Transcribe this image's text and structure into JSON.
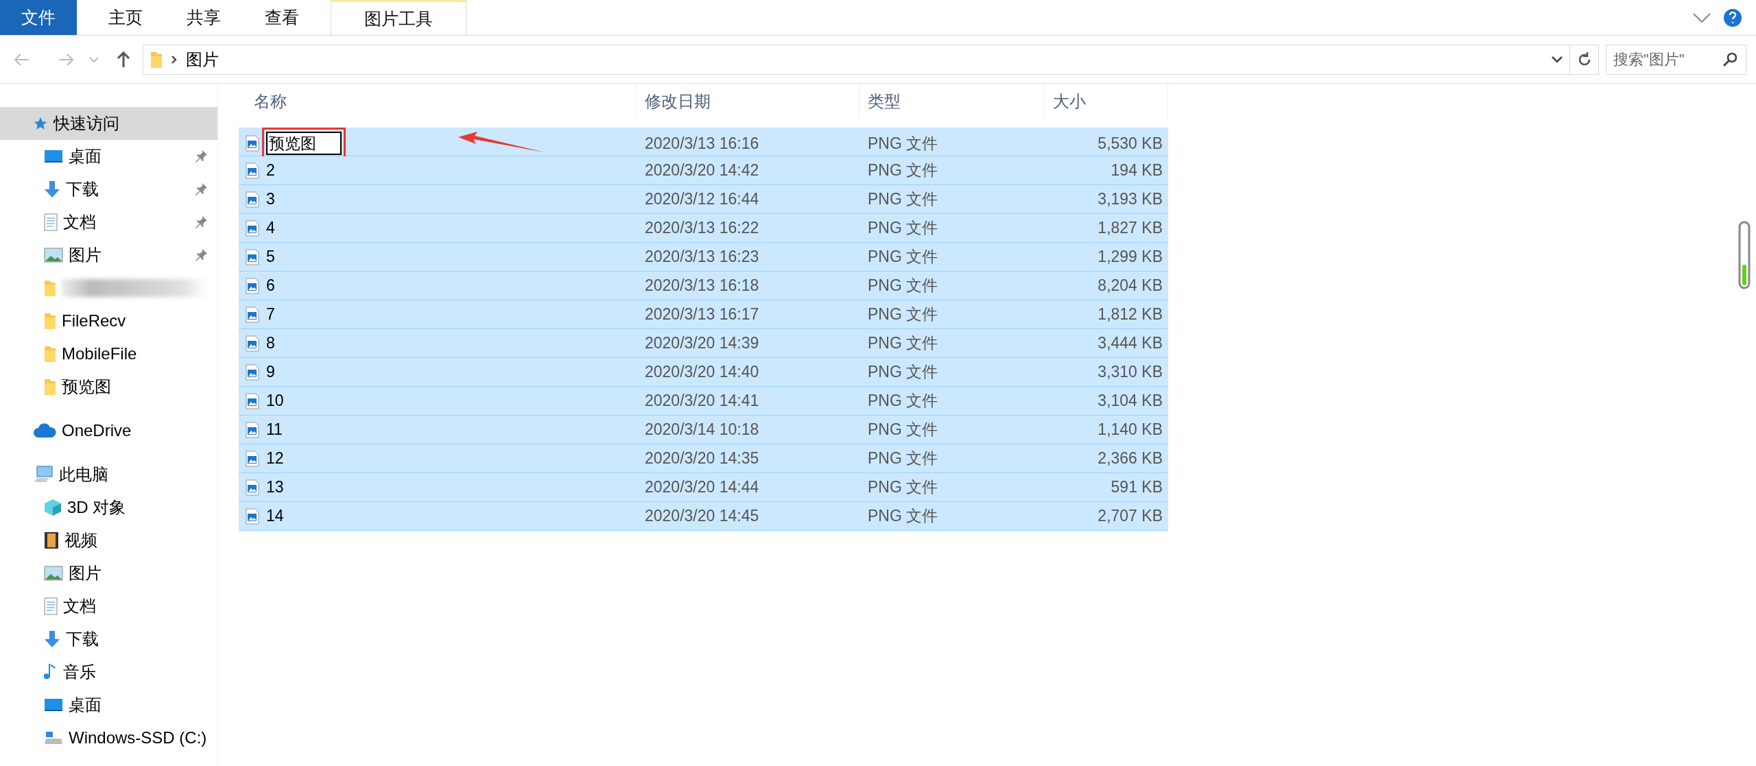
{
  "ribbon": {
    "tabs": [
      {
        "label": "文件",
        "kind": "file"
      },
      {
        "label": "主页",
        "kind": "tab"
      },
      {
        "label": "共享",
        "kind": "tab"
      },
      {
        "label": "查看",
        "kind": "tab"
      },
      {
        "label": "图片工具",
        "kind": "context"
      }
    ]
  },
  "address_bar": {
    "crumbs": [
      "图片"
    ],
    "search": {
      "placeholder": "搜索\"图片\""
    }
  },
  "sidebar": {
    "items": [
      {
        "label": "快速访问",
        "kind": "star",
        "selected": true,
        "pinned": false,
        "children": [
          {
            "label": "桌面",
            "kind": "desktop",
            "selected": false,
            "pinned": true
          },
          {
            "label": "下载",
            "kind": "download",
            "selected": false,
            "pinned": true
          },
          {
            "label": "文档",
            "kind": "document",
            "selected": false,
            "pinned": true
          },
          {
            "label": "图片",
            "kind": "picture",
            "selected": false,
            "pinned": true
          },
          {
            "kind": "redacted",
            "selected": false,
            "pinned": false
          },
          {
            "label": "FileRecv",
            "kind": "folder",
            "selected": false,
            "pinned": false
          },
          {
            "label": "MobileFile",
            "kind": "folder",
            "selected": false,
            "pinned": false
          },
          {
            "label": "预览图",
            "kind": "folder",
            "selected": false,
            "pinned": false
          }
        ]
      },
      {
        "label": "OneDrive",
        "kind": "cloud",
        "selected": false,
        "pinned": false
      },
      {
        "label": "此电脑",
        "kind": "computer",
        "selected": false,
        "pinned": false,
        "children": [
          {
            "label": "3D 对象",
            "kind": "cube",
            "selected": false,
            "pinned": false
          },
          {
            "label": "视频",
            "kind": "video",
            "selected": false,
            "pinned": false
          },
          {
            "label": "图片",
            "kind": "picture",
            "selected": false,
            "pinned": false
          },
          {
            "label": "文档",
            "kind": "document",
            "selected": false,
            "pinned": false
          },
          {
            "label": "下载",
            "kind": "download",
            "selected": false,
            "pinned": false
          },
          {
            "label": "音乐",
            "kind": "music",
            "selected": false,
            "pinned": false
          },
          {
            "label": "桌面",
            "kind": "desktop",
            "selected": false,
            "pinned": false
          },
          {
            "label": "Windows-SSD (C:)",
            "kind": "drive",
            "selected": false,
            "pinned": false
          }
        ]
      }
    ]
  },
  "table": {
    "columns": [
      "名称",
      "修改日期",
      "类型",
      "大小"
    ],
    "rows": [
      {
        "name": "预览图",
        "modified": "2020/3/13 16:16",
        "type": "PNG 文件",
        "size": "5,530 KB",
        "selected": true,
        "editing": true
      },
      {
        "name": "2",
        "modified": "2020/3/20 14:42",
        "type": "PNG 文件",
        "size": "194 KB",
        "selected": true,
        "editing": false
      },
      {
        "name": "3",
        "modified": "2020/3/12 16:44",
        "type": "PNG 文件",
        "size": "3,193 KB",
        "selected": true,
        "editing": false
      },
      {
        "name": "4",
        "modified": "2020/3/13 16:22",
        "type": "PNG 文件",
        "size": "1,827 KB",
        "selected": true,
        "editing": false
      },
      {
        "name": "5",
        "modified": "2020/3/13 16:23",
        "type": "PNG 文件",
        "size": "1,299 KB",
        "selected": true,
        "editing": false
      },
      {
        "name": "6",
        "modified": "2020/3/13 16:18",
        "type": "PNG 文件",
        "size": "8,204 KB",
        "selected": true,
        "editing": false
      },
      {
        "name": "7",
        "modified": "2020/3/13 16:17",
        "type": "PNG 文件",
        "size": "1,812 KB",
        "selected": true,
        "editing": false
      },
      {
        "name": "8",
        "modified": "2020/3/20 14:39",
        "type": "PNG 文件",
        "size": "3,444 KB",
        "selected": true,
        "editing": false
      },
      {
        "name": "9",
        "modified": "2020/3/20 14:40",
        "type": "PNG 文件",
        "size": "3,310 KB",
        "selected": true,
        "editing": false
      },
      {
        "name": "10",
        "modified": "2020/3/20 14:41",
        "type": "PNG 文件",
        "size": "3,104 KB",
        "selected": true,
        "editing": false
      },
      {
        "name": "11",
        "modified": "2020/3/14 10:18",
        "type": "PNG 文件",
        "size": "1,140 KB",
        "selected": true,
        "editing": false
      },
      {
        "name": "12",
        "modified": "2020/3/20 14:35",
        "type": "PNG 文件",
        "size": "2,366 KB",
        "selected": true,
        "editing": false
      },
      {
        "name": "13",
        "modified": "2020/3/20 14:44",
        "type": "PNG 文件",
        "size": "591 KB",
        "selected": true,
        "editing": false
      },
      {
        "name": "14",
        "modified": "2020/3/20 14:45",
        "type": "PNG 文件",
        "size": "2,707 KB",
        "selected": true,
        "editing": false
      }
    ]
  }
}
